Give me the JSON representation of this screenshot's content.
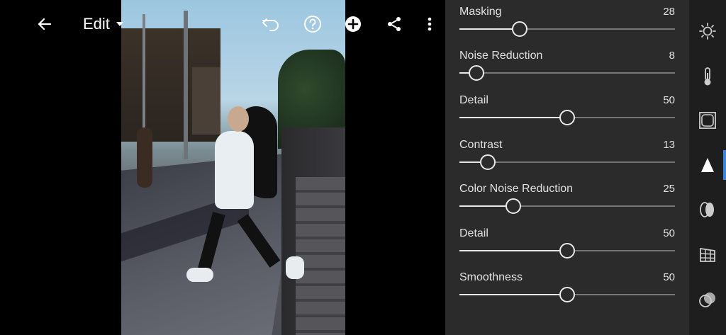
{
  "toolbar": {
    "edit_label": "Edit"
  },
  "icons": {
    "back": "arrow-left-icon",
    "undo": "undo-icon",
    "help": "help-icon",
    "add": "add-icon",
    "share": "share-icon",
    "more": "more-vert-icon"
  },
  "detail_panel": {
    "sliders": [
      {
        "label": "Masking",
        "value": "28",
        "fraction": 0.28
      },
      {
        "label": "Noise Reduction",
        "value": "8",
        "fraction": 0.08
      },
      {
        "label": "Detail",
        "value": "50",
        "fraction": 0.5
      },
      {
        "label": "Contrast",
        "value": "13",
        "fraction": 0.13
      },
      {
        "label": "Color Noise Reduction",
        "value": "25",
        "fraction": 0.25
      },
      {
        "label": "Detail",
        "value": "50",
        "fraction": 0.5
      },
      {
        "label": "Smoothness",
        "value": "50",
        "fraction": 0.5
      }
    ]
  },
  "tools": [
    {
      "name": "light-icon",
      "active": false
    },
    {
      "name": "color-icon",
      "active": false
    },
    {
      "name": "effects-icon",
      "active": false
    },
    {
      "name": "detail-icon",
      "active": true
    },
    {
      "name": "optics-icon",
      "active": false
    },
    {
      "name": "geometry-icon",
      "active": false
    },
    {
      "name": "presets-icon",
      "active": false
    }
  ],
  "colors": {
    "panel_bg": "#2b2b2b",
    "toolstrip_bg": "#1e1e1e",
    "accent": "#3d85d8",
    "slider_fill": "#e8e8e8",
    "slider_track": "#777777"
  }
}
